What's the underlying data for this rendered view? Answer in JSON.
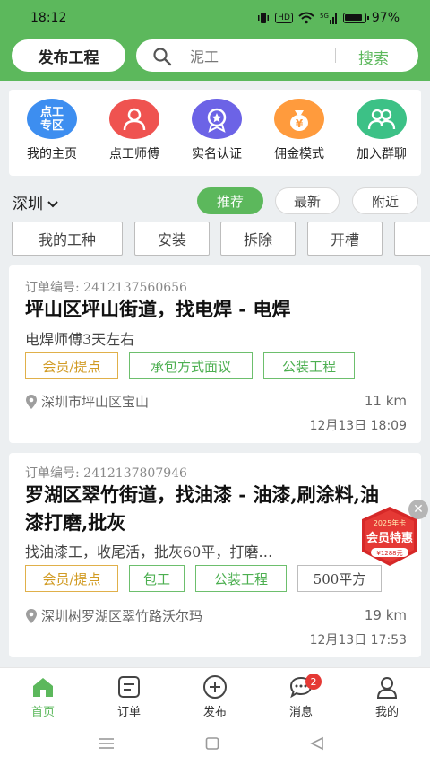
{
  "status_bar": {
    "time": "18:12",
    "battery": "97%",
    "network": "HD",
    "signal": "5G"
  },
  "header": {
    "publish_label": "发布工程",
    "search_value": "泥工",
    "search_button": "搜索"
  },
  "quick_links": [
    {
      "label": "我的主页",
      "icon": "dian-gong-zhuan-qu-badge",
      "icon_text_1": "点工",
      "icon_text_2": "专区",
      "color": "#3d8ef0"
    },
    {
      "label": "点工师傅",
      "icon": "workers-icon",
      "color": "#ef5350"
    },
    {
      "label": "实名认证",
      "icon": "verified-badge-icon",
      "color": "#6c63e6"
    },
    {
      "label": "佣金模式",
      "icon": "money-bag-icon",
      "color": "#ff9b3d"
    },
    {
      "label": "加入群聊",
      "icon": "group-chat-icon",
      "color": "#3cc186"
    }
  ],
  "filters": {
    "city": "深圳",
    "sort_options": [
      "推荐",
      "最新",
      "附近"
    ],
    "active_sort": "推荐",
    "work_types": [
      "我的工种",
      "安装",
      "拆除",
      "开槽"
    ]
  },
  "orders": [
    {
      "order_no": "订单编号: 2412137560656",
      "title": "坪山区坪山街道，找电焊 - 电焊",
      "desc": "电焊师傅3天左右",
      "tags": [
        {
          "text": "会员/提点",
          "style": "gold"
        },
        {
          "text": "承包方式面议",
          "style": "green"
        },
        {
          "text": "公装工程",
          "style": "green"
        }
      ],
      "location": "深圳市坪山区宝山",
      "distance": "11 km",
      "datetime": "12月13日  18:09"
    },
    {
      "order_no": "订单编号: 2412137807946",
      "title": "罗湖区翠竹街道，找油漆 - 油漆,刷涂料,油漆打磨,批灰",
      "desc": "找油漆工，收尾活，批灰60平，打磨…",
      "tags": [
        {
          "text": "会员/提点",
          "style": "gold"
        },
        {
          "text": "包工",
          "style": "green"
        },
        {
          "text": "公装工程",
          "style": "green"
        },
        {
          "text": "500平方",
          "style": "gray"
        }
      ],
      "location": "深圳树罗湖区翠竹路沃尔玛",
      "distance": "19 km",
      "datetime": "12月13日  17:53"
    }
  ],
  "promo": {
    "year": "2025年卡",
    "title": "会员特惠",
    "price": "¥1288元"
  },
  "tabbar": [
    {
      "label": "首页",
      "icon": "home-icon",
      "active": true
    },
    {
      "label": "订单",
      "icon": "order-icon",
      "active": false
    },
    {
      "label": "发布",
      "icon": "publish-plus-icon",
      "active": false
    },
    {
      "label": "消息",
      "icon": "message-icon",
      "active": false,
      "badge": "2"
    },
    {
      "label": "我的",
      "icon": "profile-icon",
      "active": false
    }
  ],
  "colors": {
    "brand_green": "#5cb85c",
    "gold": "#d19b23",
    "badge_red": "#e53935"
  }
}
